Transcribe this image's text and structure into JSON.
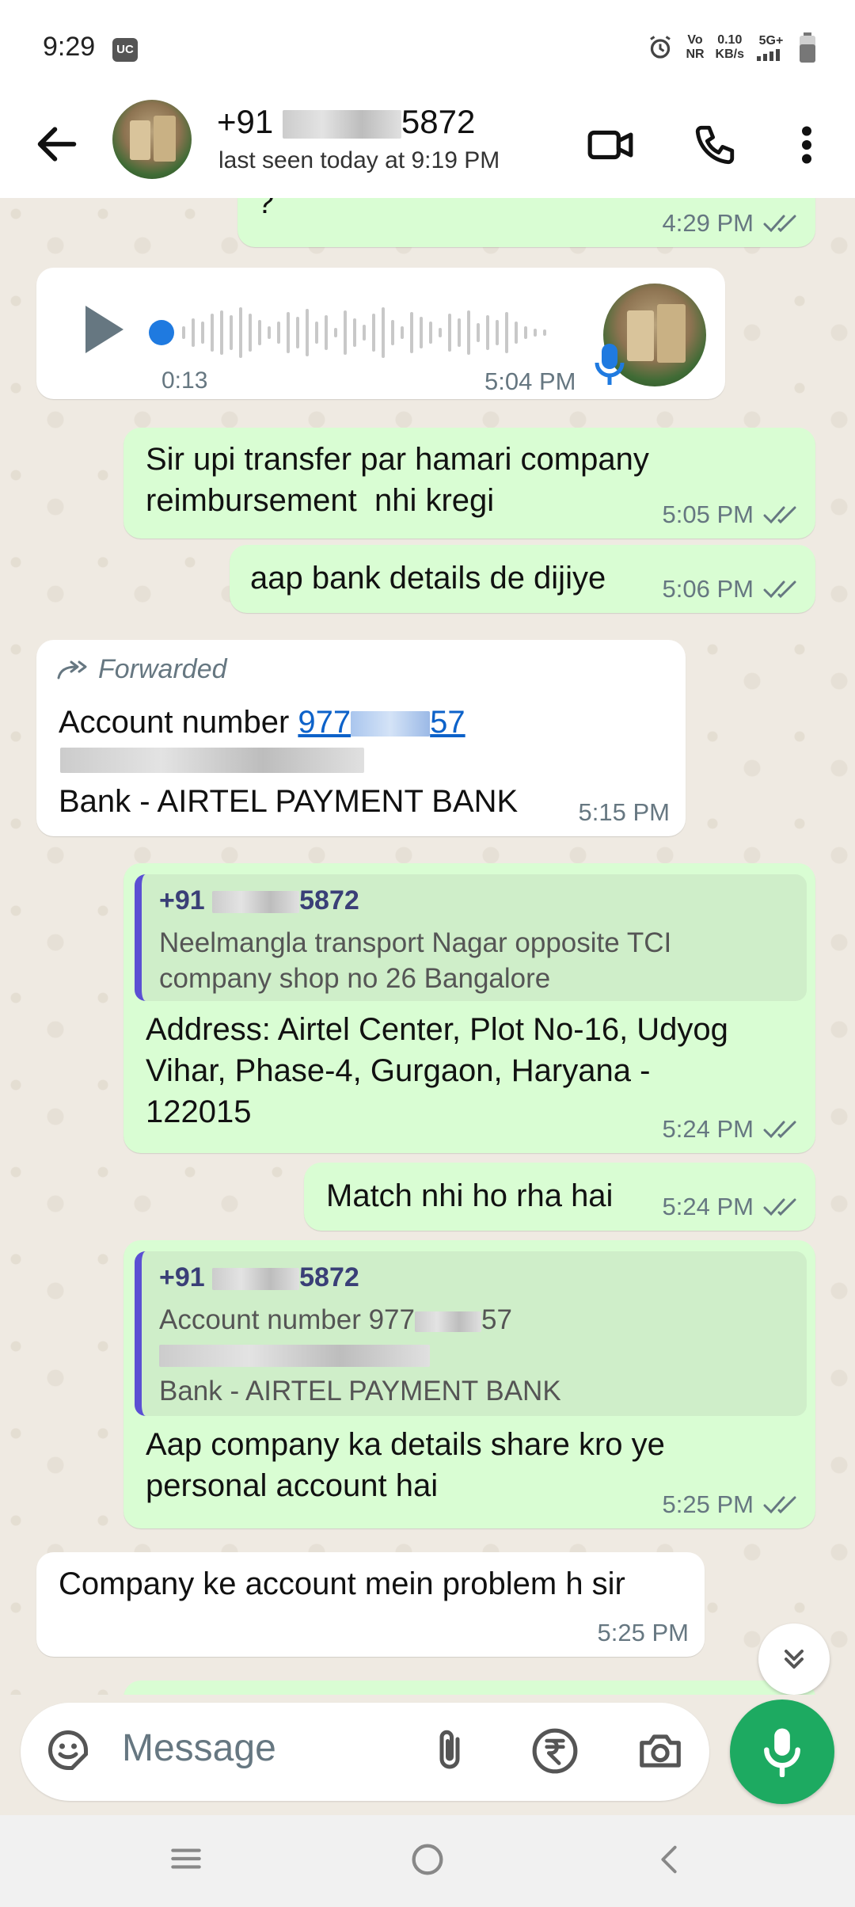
{
  "status_bar": {
    "time": "9:29",
    "uc_badge": "UC",
    "network_type": "Vo NR",
    "network_top": "Vo",
    "network_bottom": "NR",
    "speed_top": "0.10",
    "speed_bottom": "KB/s",
    "signal": "5G+"
  },
  "header": {
    "name_prefix": "+91",
    "name_suffix": "5872",
    "last_seen": "last seen today at 9:19 PM",
    "icons": [
      "back-arrow-icon",
      "video-call-icon",
      "phone-icon",
      "more-vert-icon"
    ]
  },
  "messages": [
    {
      "type": "outgoing",
      "text": "?",
      "time": "4:29 PM"
    },
    {
      "type": "incoming-voice",
      "duration": "0:13",
      "time": "5:04 PM"
    },
    {
      "type": "outgoing",
      "text": "Sir upi transfer par hamari company reimbursement  nhi kregi",
      "line1": "Sir upi transfer par hamari company",
      "line2": "reimbursement  nhi kregi",
      "time": "5:05 PM"
    },
    {
      "type": "outgoing",
      "text": "aap bank details de dijiye",
      "time": "5:06 PM"
    },
    {
      "type": "incoming-forwarded",
      "forwarded_label": "Forwarded",
      "account_label": "Account number",
      "account_prefix": "977",
      "account_suffix": "57",
      "bank_line": "Bank - AIRTEL PAYMENT BANK",
      "time": "5:15 PM"
    },
    {
      "type": "outgoing-reply",
      "quote_name_prefix": "+91",
      "quote_name_suffix": "5872",
      "quote_line1": "Neelmangla transport Nagar opposite TCI",
      "quote_line2": "company shop no 26 Bangalore",
      "line1": "Address: Airtel Center, Plot No-16, Udyog",
      "line2": "Vihar, Phase-4, Gurgaon, Haryana -",
      "line3": "122015",
      "time": "5:24 PM"
    },
    {
      "type": "outgoing",
      "text": "Match nhi ho rha hai",
      "time": "5:24 PM"
    },
    {
      "type": "outgoing-reply",
      "quote_name_prefix": "+91",
      "quote_name_suffix": "5872",
      "quote_account_prefix": "Account number 977",
      "quote_account_suffix": "57",
      "quote_bank": "Bank - AIRTEL PAYMENT BANK",
      "line1": "Aap company ka details share kro ye",
      "line2": "personal account hai",
      "time": "5:25 PM"
    },
    {
      "type": "incoming",
      "text": "Company ke account mein problem h sir",
      "time": "5:25 PM"
    }
  ],
  "input": {
    "placeholder": "Message",
    "icons": [
      "sticker-icon",
      "attach-icon",
      "rupee-payment-icon",
      "camera-icon",
      "mic-icon"
    ]
  },
  "colors": {
    "outgoing_bubble": "#d9fdd3",
    "incoming_bubble": "#ffffff",
    "chat_background": "#efeae2",
    "accent_green": "#1daa61",
    "link_blue": "#0d62c9",
    "quote_bar": "#5b4fd3"
  }
}
